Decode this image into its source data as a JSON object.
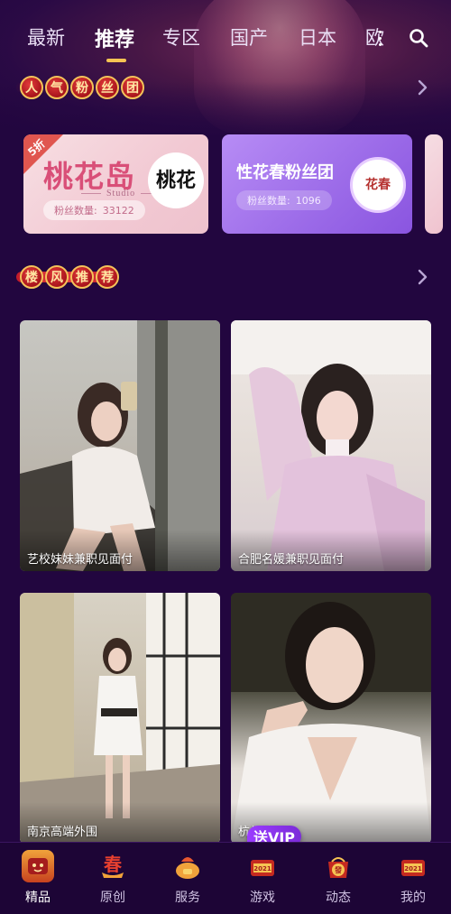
{
  "top_tabs": [
    {
      "label": "最新",
      "active": false
    },
    {
      "label": "推荐",
      "active": true
    },
    {
      "label": "专区",
      "active": false
    },
    {
      "label": "国产",
      "active": false
    },
    {
      "label": "日本",
      "active": false
    },
    {
      "label": "欧",
      "active": false
    }
  ],
  "sections": {
    "fans": {
      "title_chars": [
        "人",
        "气",
        "粉",
        "丝",
        "团"
      ]
    },
    "recommend": {
      "title_chars": [
        "楼",
        "风",
        "推",
        "荐"
      ]
    }
  },
  "fan_clubs": [
    {
      "brand_text": "桃花岛",
      "brand_sub": "Studio",
      "logo_text": "桃花",
      "discount": "5折",
      "fans_label": "粉丝数量:",
      "fans_count": "33122"
    },
    {
      "title": "性花春粉丝团",
      "logo_text": "花春",
      "fans_label": "粉丝数量:",
      "fans_count": "1096"
    }
  ],
  "photos": [
    {
      "caption": "艺校妹妹兼职见面付"
    },
    {
      "caption": "合肥名媛兼职见面付"
    },
    {
      "caption": "南京高端外围"
    },
    {
      "caption": "杭州外围"
    }
  ],
  "vip_badge": "送VIP",
  "bottom_nav": [
    {
      "label": "精品",
      "icon": "jingpin-icon",
      "active": true
    },
    {
      "label": "原创",
      "icon": "chun-icon",
      "active": false
    },
    {
      "label": "服务",
      "icon": "service-icon",
      "active": false
    },
    {
      "label": "游戏",
      "icon": "game-2021-icon",
      "active": false
    },
    {
      "label": "动态",
      "icon": "fa-icon",
      "active": false
    },
    {
      "label": "我的",
      "icon": "my-2021-icon",
      "active": false
    }
  ],
  "colors": {
    "background": "#22063f",
    "accent_gold": "#f6c453",
    "ribbon_red": "#c21a2a",
    "card_purple": "#9b6ae8",
    "card_pink": "#f2c9d3"
  }
}
